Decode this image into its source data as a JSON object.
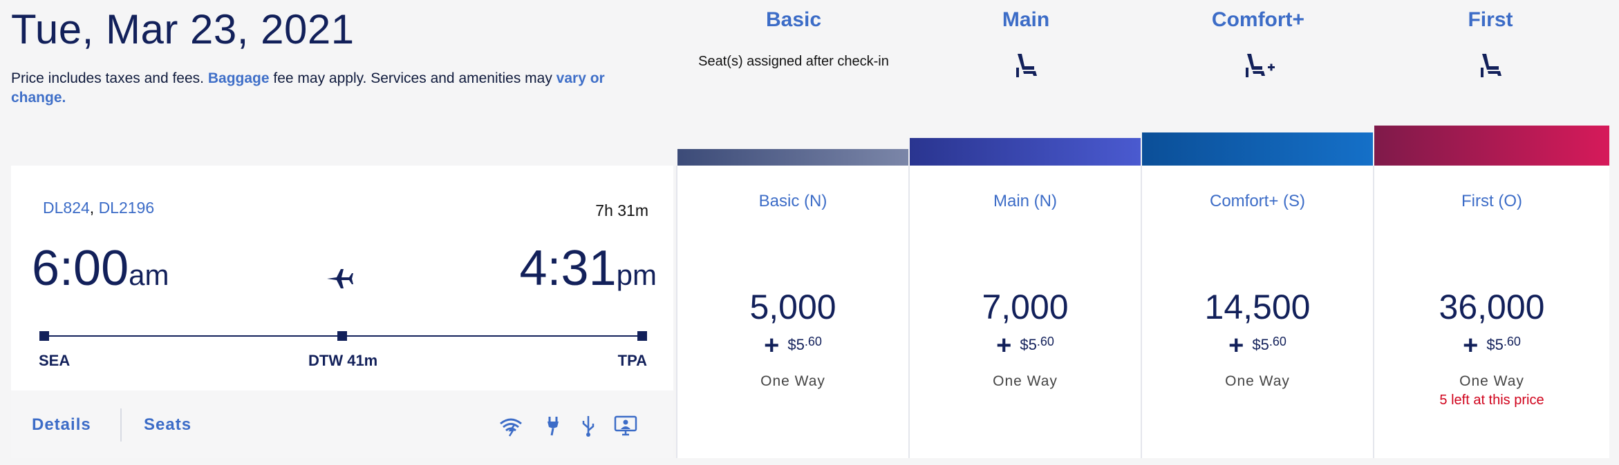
{
  "header": {
    "date": "Tue, Mar 23, 2021",
    "note_pre": "Price includes taxes and fees.",
    "note_link1": "Baggage",
    "note_mid": " fee may apply. Services and amenities may ",
    "note_link2": "vary or change."
  },
  "fare_columns": [
    {
      "name": "Basic",
      "subtitle": "Seat(s) assigned after check-in",
      "icon": "none",
      "bar_color": "#3d4f7c"
    },
    {
      "name": "Main",
      "icon": "seat-icon",
      "bar_color": "#2f3fa6"
    },
    {
      "name": "Comfort+",
      "icon": "seat-plus-icon",
      "bar_color": "#0f5fb1"
    },
    {
      "name": "First",
      "icon": "seat-icon",
      "bar_color": "#b5164f"
    }
  ],
  "flight": {
    "flight_numbers": [
      "DL824",
      "DL2196"
    ],
    "separator": ",",
    "duration": "7h 31m",
    "depart_time": "6:00",
    "depart_ampm": "am",
    "arrive_time": "4:31",
    "arrive_ampm": "pm",
    "origin": "SEA",
    "stopover": "DTW 41m",
    "destination": "TPA",
    "details_label": "Details",
    "seats_label": "Seats",
    "amenities": [
      "wifi-icon",
      "power-plug-icon",
      "usb-icon",
      "entertainment-screen-icon"
    ]
  },
  "fares": [
    {
      "code": "Basic (N)",
      "miles": "5,000",
      "plus": "+",
      "fee_dollars": "$5",
      "fee_cents": ".60",
      "trip": "One Way",
      "availability": ""
    },
    {
      "code": "Main (N)",
      "miles": "7,000",
      "plus": "+",
      "fee_dollars": "$5",
      "fee_cents": ".60",
      "trip": "One Way",
      "availability": ""
    },
    {
      "code": "Comfort+ (S)",
      "miles": "14,500",
      "plus": "+",
      "fee_dollars": "$5",
      "fee_cents": ".60",
      "trip": "One Way",
      "availability": ""
    },
    {
      "code": "First (O)",
      "miles": "36,000",
      "plus": "+",
      "fee_dollars": "$5",
      "fee_cents": ".60",
      "trip": "One Way",
      "availability": "5 left at this price"
    }
  ],
  "colors": {
    "link": "#3c6cc7",
    "navy": "#12205a",
    "alert": "#d0021b"
  }
}
